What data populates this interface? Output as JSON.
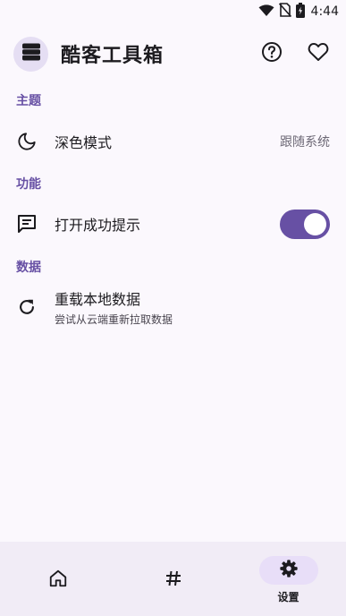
{
  "status_bar": {
    "time": "4:44"
  },
  "header": {
    "title": "酷客工具箱",
    "icons": [
      "stack-icon",
      "help-icon",
      "heart-icon"
    ]
  },
  "sections": [
    {
      "title": "主题",
      "items": [
        {
          "icon": "moon-icon",
          "label": "深色模式",
          "value": "跟随系统"
        }
      ]
    },
    {
      "title": "功能",
      "items": [
        {
          "icon": "message-icon",
          "label": "打开成功提示",
          "toggle": true
        }
      ]
    },
    {
      "title": "数据",
      "items": [
        {
          "icon": "refresh-icon",
          "label": "重载本地数据",
          "subtitle": "尝试从云端重新拉取数据"
        }
      ]
    }
  ],
  "bottom_nav": {
    "items": [
      {
        "icon": "home-icon",
        "label": ""
      },
      {
        "icon": "hash-icon",
        "label": ""
      },
      {
        "icon": "settings-icon",
        "label": "设置",
        "active": true
      }
    ]
  },
  "colors": {
    "accent": "#6750a4",
    "background": "#fbf8fd",
    "nav_background": "#f1ecf6",
    "active_pill": "#e8def8"
  }
}
